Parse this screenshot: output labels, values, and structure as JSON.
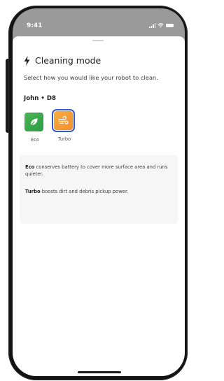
{
  "status_bar": {
    "time": "9:41",
    "icons": [
      "signal-icon",
      "wifi-icon",
      "battery-icon"
    ]
  },
  "sheet": {
    "title_icon": "bolt-icon",
    "title": "Cleaning mode",
    "subtitle": "Select how you would like your robot to clean.",
    "device_name": "John • D8",
    "modes": [
      {
        "label": "Eco",
        "icon": "leaf-icon",
        "color": "#3aa54a",
        "selected": false
      },
      {
        "label": "Turbo",
        "icon": "wind-icon",
        "color": "#f5a13a",
        "selected": true
      }
    ],
    "info": [
      {
        "bold": "Eco",
        "text": " conserves battery to cover more surface area and runs quieter."
      },
      {
        "bold": "Turbo",
        "text": " boosts dirt and debris pickup power."
      }
    ]
  },
  "colors": {
    "accent_selected_outline": "#3558c4",
    "sheet_background": "#ffffff",
    "dimmed_backdrop": "#9a9a9a"
  }
}
